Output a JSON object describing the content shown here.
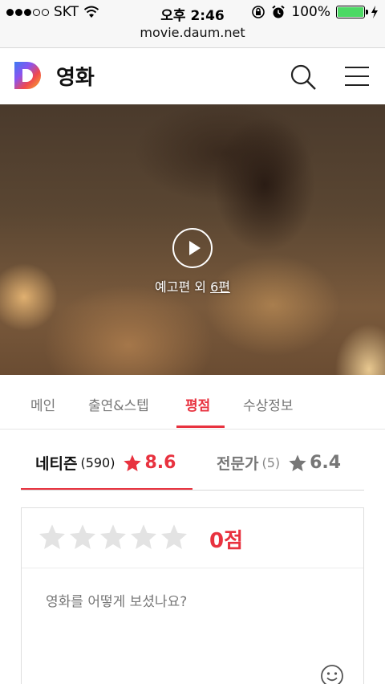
{
  "status_bar": {
    "carrier": "SKT",
    "time": "오후 2:46",
    "battery": "100%",
    "signal_bars": 3,
    "battery_color": "#4cd964"
  },
  "browser": {
    "url": "movie.daum.net"
  },
  "header": {
    "title": "영화",
    "logo": "daum-logo",
    "search_icon": "search-icon",
    "menu_icon": "hamburger-menu-icon"
  },
  "hero": {
    "trailer_prefix": "예고편 외",
    "trailer_count": "6편",
    "play_icon": "play-icon"
  },
  "tabs": [
    {
      "label": "메인",
      "active": false
    },
    {
      "label": "출연&스텝",
      "active": false
    },
    {
      "label": "평점",
      "active": true
    },
    {
      "label": "수상정보",
      "active": false
    }
  ],
  "rating_tabs": {
    "netizen": {
      "name": "네티즌",
      "count": "(590)",
      "score": "8.6"
    },
    "expert": {
      "name": "전문가",
      "count": "(5)",
      "score": "6.4"
    }
  },
  "rating_input": {
    "stars": 5,
    "points": "0점",
    "placeholder": "영화를 어떻게 보셨나요?",
    "emoji_icon": "smiley-icon"
  },
  "colors": {
    "accent": "#e8323f",
    "muted_star": "#e3e3e3",
    "expert_star": "#777777"
  }
}
